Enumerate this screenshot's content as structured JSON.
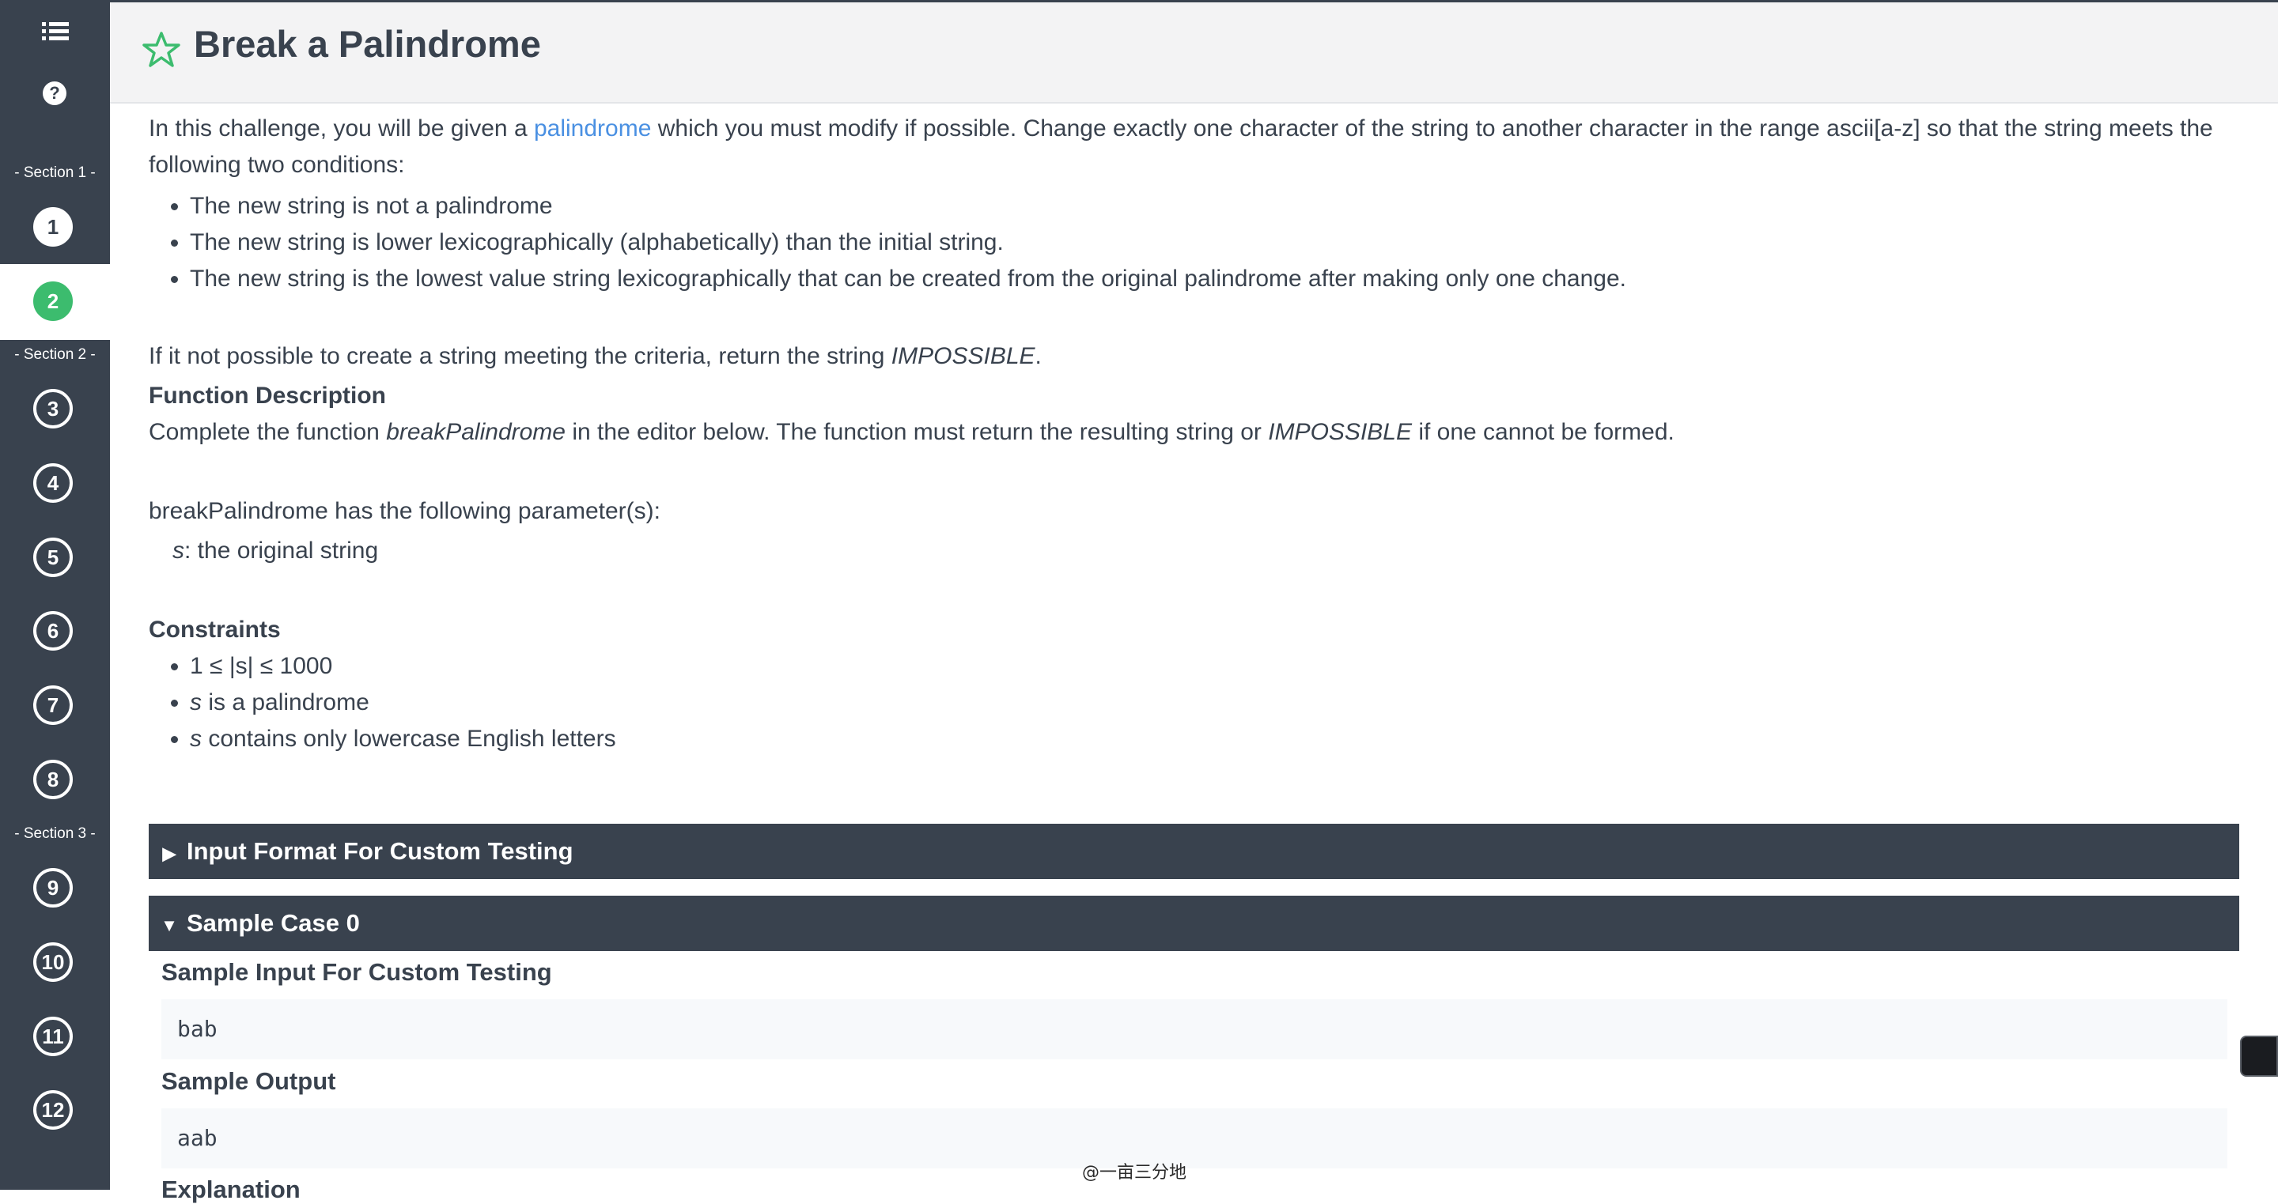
{
  "sidebar": {
    "menu_icon": "list-icon",
    "help_label": "?",
    "sections": [
      "- Section 1 -",
      "- Section 2 -",
      "- Section 3 -"
    ],
    "questions": [
      "1",
      "2",
      "3",
      "4",
      "5",
      "6",
      "7",
      "8",
      "9",
      "10",
      "11",
      "12"
    ],
    "completed_question": "1",
    "active_question": "2"
  },
  "header": {
    "title": "Break a Palindrome",
    "star_icon": "star-outline-icon",
    "star_color": "#3cbc6e"
  },
  "content": {
    "intro_before": "In this challenge, you will be given a ",
    "intro_link": "palindrome",
    "intro_after": " which you must modify if possible. Change exactly one character of the string to another character in the range ascii[a-z] so that the string meets the following two conditions:",
    "conditions": [
      "The new string is not a palindrome",
      "The new string is lower lexicographically (alphabetically) than the initial string.",
      "The new string is the lowest value string lexicographically that can be created from the original palindrome after making only one change."
    ],
    "impossible_before": "If it not possible to create a string meeting the criteria, return the string ",
    "impossible_word": "IMPOSSIBLE",
    "impossible_after": ".",
    "function_heading": "Function Description",
    "function_before": "Complete the function ",
    "function_name": "breakPalindrome",
    "function_middle": " in the editor below. The function must return the resulting string or ",
    "function_impossible": "IMPOSSIBLE",
    "function_after": " if one cannot be formed.",
    "params_intro": "breakPalindrome has the following parameter(s):",
    "param_name": "s",
    "param_desc": ":  the original string",
    "constraints_heading": "Constraints",
    "constraint_1": "1 ≤ |s| ≤ 1000",
    "constraint_2_var": "s",
    "constraint_2_text": " is a palindrome",
    "constraint_3_var": "s",
    "constraint_3_text": " contains only lowercase English letters"
  },
  "sections": {
    "input_format_label": "Input Format For Custom Testing",
    "sample_case_label": "Sample Case 0",
    "sample_input_heading": "Sample Input For Custom Testing",
    "sample_input_value": "bab",
    "sample_output_heading": "Sample Output",
    "sample_output_value": "aab",
    "explanation_heading": "Explanation"
  },
  "watermark": "@一亩三分地",
  "colors": {
    "sidebar_bg": "#39424e",
    "active_green": "#3cbc6e",
    "link_blue": "#4a90e2",
    "header_bg": "#f3f3f4"
  }
}
